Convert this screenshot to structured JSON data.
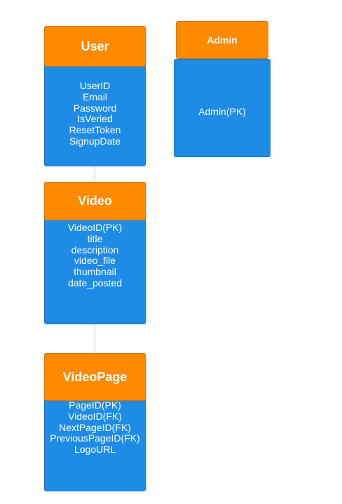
{
  "colors": {
    "header": "#ff8a00",
    "body": "#1e8ce6",
    "text": "#ffffff",
    "connector": "#b8c4d0"
  },
  "entities": {
    "user": {
      "title": "User",
      "fields": [
        "UserID",
        "Email",
        "Password",
        "IsVeried",
        "ResetToken",
        "SignupDate"
      ]
    },
    "admin": {
      "title": "Admin",
      "fields": [
        "Admin(PK)"
      ]
    },
    "video": {
      "title": "Video",
      "fields": [
        "VideoID(PK)",
        "title",
        "description",
        "video_file",
        "thumbnail",
        "date_posted"
      ]
    },
    "videopage": {
      "title": "VideoPage",
      "fields": [
        "PageID(PK)",
        "VideoID(FK)",
        "NextPageID(FK)",
        "PreviousPageID(FK)",
        "LogoURL"
      ]
    }
  },
  "relationships": [
    {
      "from": "user",
      "to": "video"
    },
    {
      "from": "video",
      "to": "videopage"
    }
  ]
}
